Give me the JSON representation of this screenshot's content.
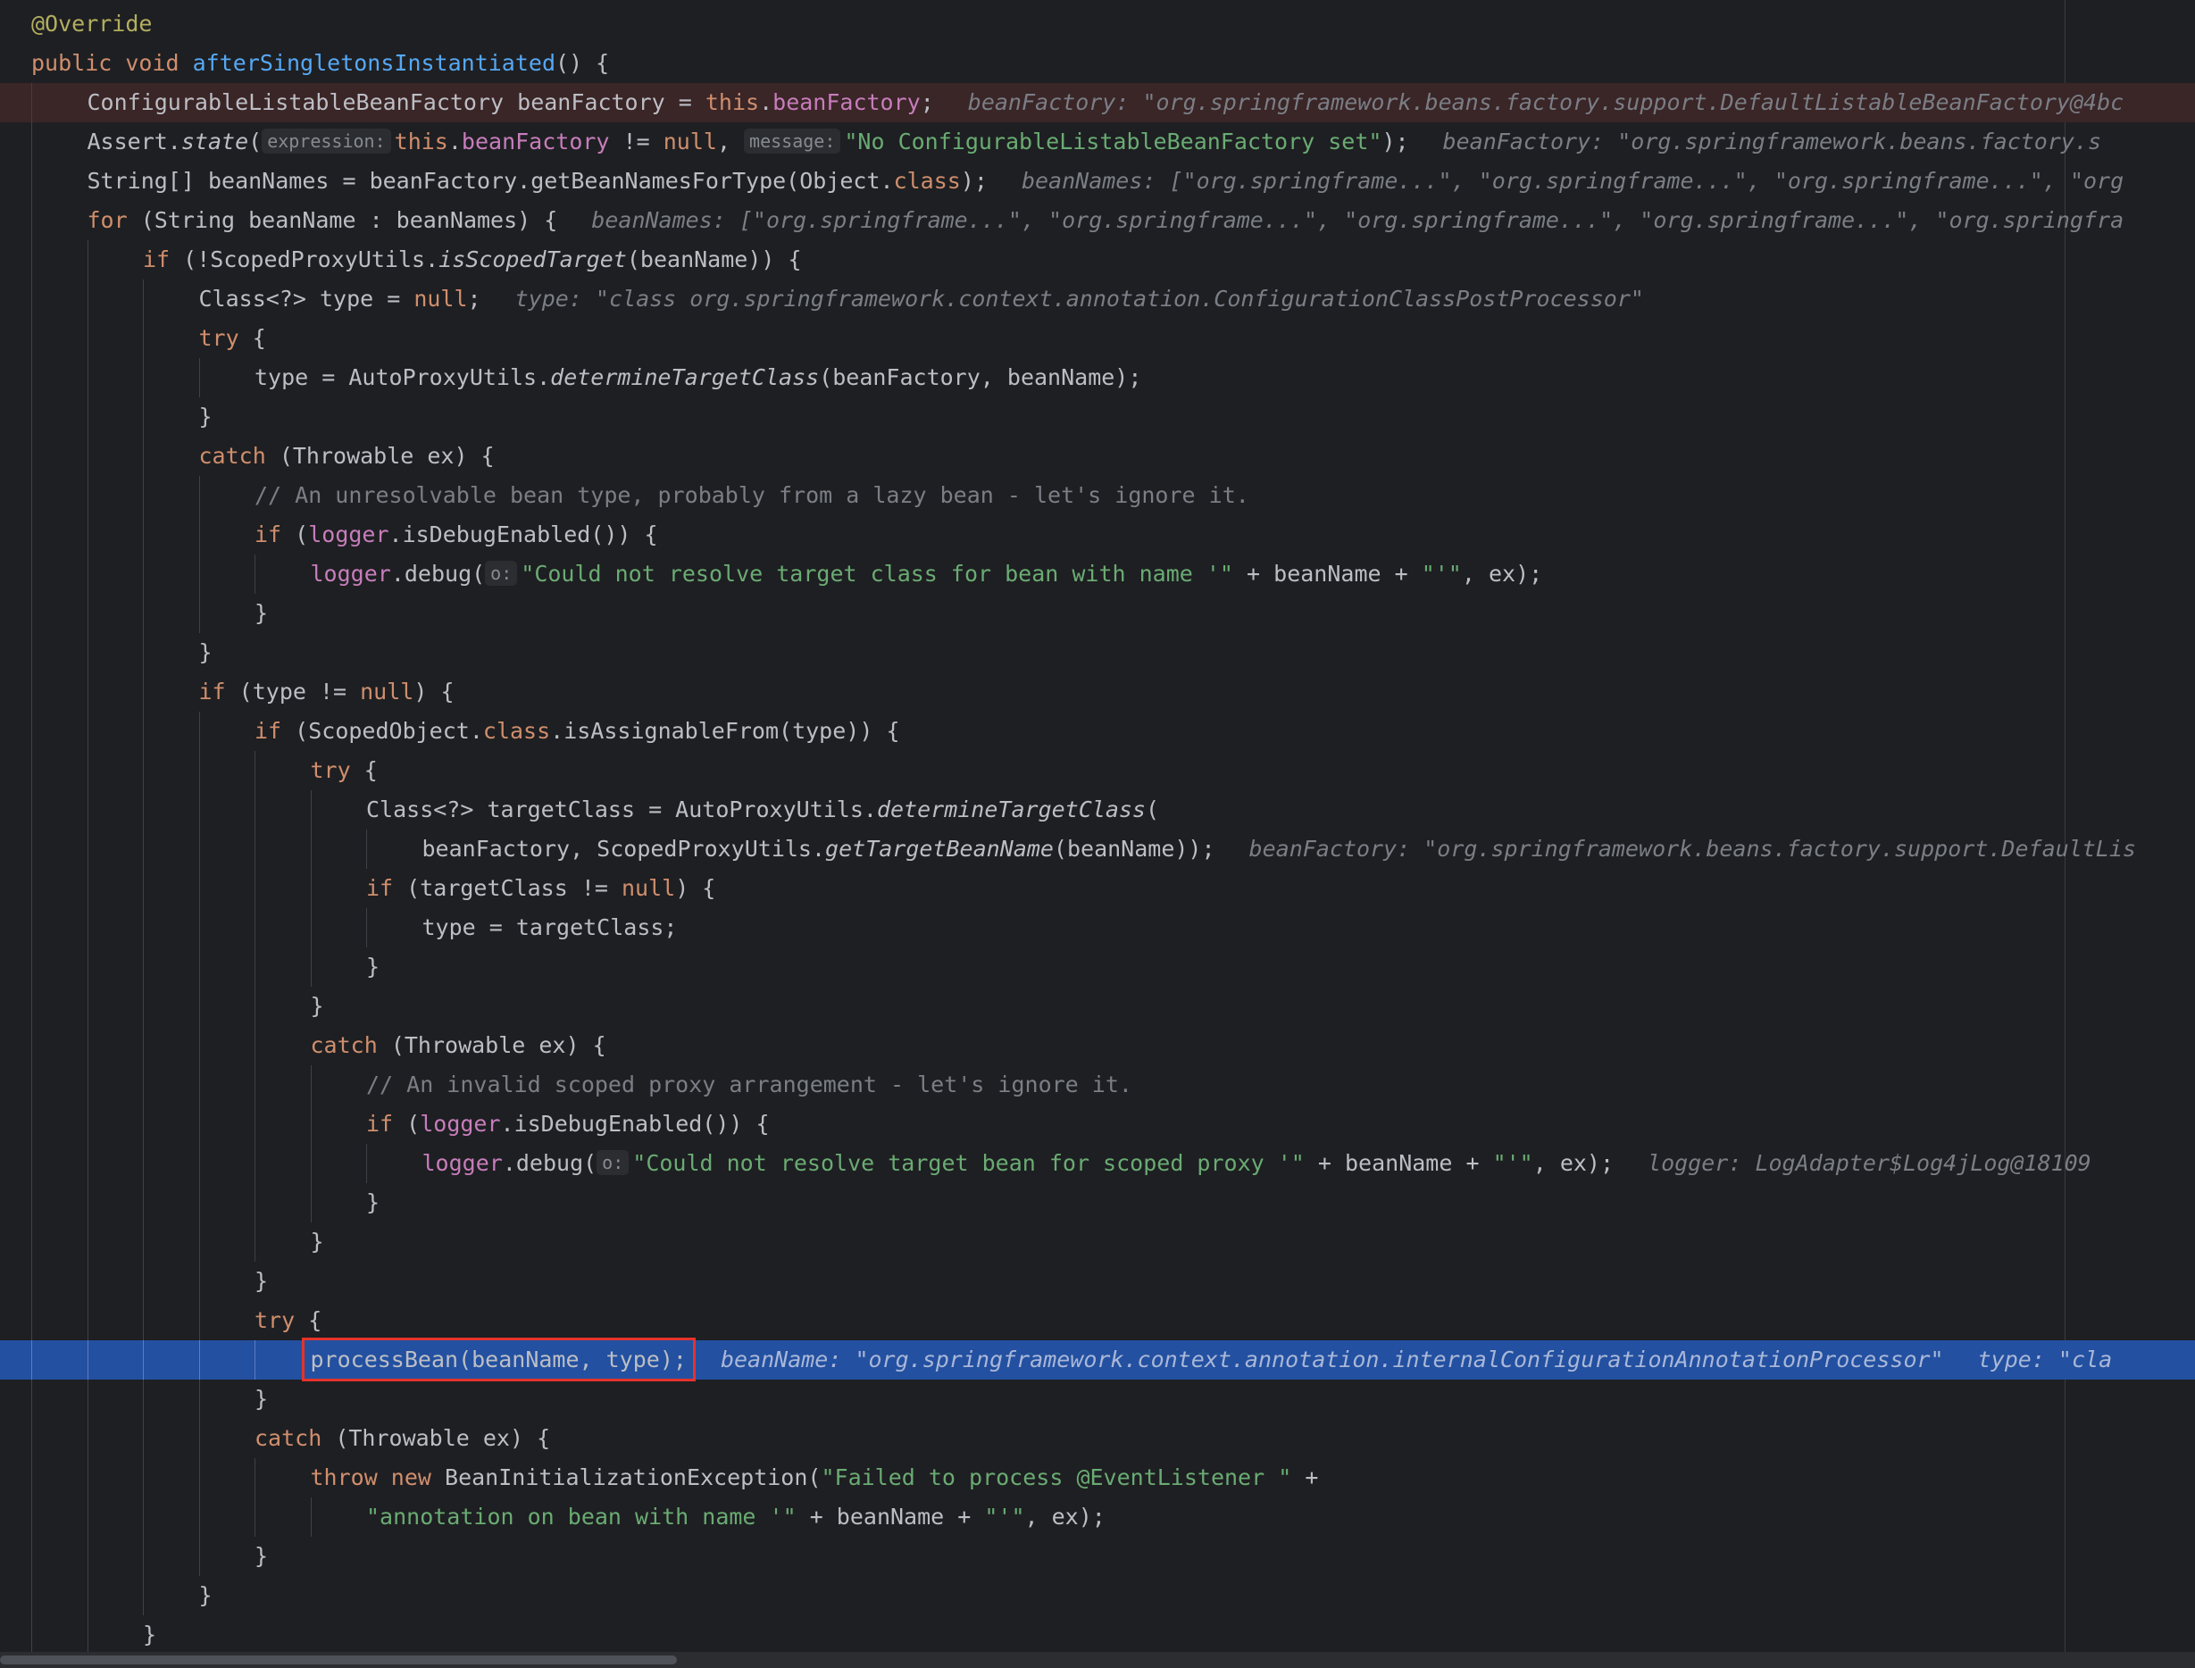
{
  "editor": {
    "lines": [
      {
        "indent": 0,
        "segs": [
          {
            "t": "@Override",
            "c": "ann"
          }
        ]
      },
      {
        "indent": 0,
        "segs": [
          {
            "t": "public void ",
            "c": "kw"
          },
          {
            "t": "afterSingletonsInstantiated",
            "c": "fn"
          },
          {
            "t": "() {"
          }
        ]
      },
      {
        "indent": 1,
        "state": "breakpoint",
        "segs": [
          {
            "t": "ConfigurableListableBeanFactory beanFactory = "
          },
          {
            "t": "this",
            "c": "kw"
          },
          {
            "t": "."
          },
          {
            "t": "beanFactory",
            "c": "fld"
          },
          {
            "t": ";"
          },
          {
            "t": "beanFactory: \"org.springframework.beans.factory.support.DefaultListableBeanFactory@4bc",
            "c": "hint"
          }
        ]
      },
      {
        "indent": 1,
        "segs": [
          {
            "t": "Assert."
          },
          {
            "t": "state",
            "c": "it"
          },
          {
            "t": "("
          },
          {
            "t": "expression:",
            "c": "phint"
          },
          {
            "t": "this",
            "c": "kw"
          },
          {
            "t": "."
          },
          {
            "t": "beanFactory",
            "c": "fld"
          },
          {
            "t": " != "
          },
          {
            "t": "null",
            "c": "kw"
          },
          {
            "t": ", "
          },
          {
            "t": "message:",
            "c": "phint"
          },
          {
            "t": "\"No ConfigurableListableBeanFactory set\"",
            "c": "str"
          },
          {
            "t": ");"
          },
          {
            "t": "beanFactory: \"org.springframework.beans.factory.s",
            "c": "hint"
          }
        ]
      },
      {
        "indent": 1,
        "segs": [
          {
            "t": "String[] beanNames = beanFactory.getBeanNamesForType(Object."
          },
          {
            "t": "class",
            "c": "kw"
          },
          {
            "t": ");"
          },
          {
            "t": "beanNames: [\"org.springframe...\", \"org.springframe...\", \"org.springframe...\", \"org",
            "c": "hint"
          }
        ]
      },
      {
        "indent": 1,
        "segs": [
          {
            "t": "for",
            "c": "kw"
          },
          {
            "t": " (String beanName : beanNames) {"
          },
          {
            "t": "beanNames: [\"org.springframe...\", \"org.springframe...\", \"org.springframe...\", \"org.springframe...\", \"org.springfra",
            "c": "hint"
          }
        ]
      },
      {
        "indent": 2,
        "segs": [
          {
            "t": "if",
            "c": "kw"
          },
          {
            "t": " (!ScopedProxyUtils."
          },
          {
            "t": "isScopedTarget",
            "c": "it"
          },
          {
            "t": "(beanName)) {"
          }
        ]
      },
      {
        "indent": 3,
        "segs": [
          {
            "t": "Class<?> type = "
          },
          {
            "t": "null",
            "c": "kw"
          },
          {
            "t": ";"
          },
          {
            "t": "type: \"class org.springframework.context.annotation.ConfigurationClassPostProcessor\"",
            "c": "hint"
          }
        ]
      },
      {
        "indent": 3,
        "segs": [
          {
            "t": "try",
            "c": "kw"
          },
          {
            "t": " {"
          }
        ]
      },
      {
        "indent": 4,
        "segs": [
          {
            "t": "type = AutoProxyUtils."
          },
          {
            "t": "determineTargetClass",
            "c": "it"
          },
          {
            "t": "(beanFactory, beanName);"
          }
        ]
      },
      {
        "indent": 3,
        "segs": [
          {
            "t": "}"
          }
        ]
      },
      {
        "indent": 3,
        "segs": [
          {
            "t": "catch",
            "c": "kw"
          },
          {
            "t": " (Throwable ex) {"
          }
        ]
      },
      {
        "indent": 4,
        "segs": [
          {
            "t": "// An unresolvable bean type, probably from a lazy bean - let's ignore it.",
            "c": "cmt"
          }
        ]
      },
      {
        "indent": 4,
        "segs": [
          {
            "t": "if",
            "c": "kw"
          },
          {
            "t": " ("
          },
          {
            "t": "logger",
            "c": "fld"
          },
          {
            "t": ".isDebugEnabled()) {"
          }
        ]
      },
      {
        "indent": 5,
        "segs": [
          {
            "t": "logger",
            "c": "fld"
          },
          {
            "t": ".debug("
          },
          {
            "t": "o:",
            "c": "phint"
          },
          {
            "t": "\"Could not resolve target class for bean with name '\"",
            "c": "str"
          },
          {
            "t": " + beanName + "
          },
          {
            "t": "\"'\"",
            "c": "str"
          },
          {
            "t": ", ex);"
          }
        ]
      },
      {
        "indent": 4,
        "segs": [
          {
            "t": "}"
          }
        ]
      },
      {
        "indent": 3,
        "segs": [
          {
            "t": "}"
          }
        ]
      },
      {
        "indent": 3,
        "segs": [
          {
            "t": "if",
            "c": "kw"
          },
          {
            "t": " (type != "
          },
          {
            "t": "null",
            "c": "kw"
          },
          {
            "t": ") {"
          }
        ]
      },
      {
        "indent": 4,
        "segs": [
          {
            "t": "if",
            "c": "kw"
          },
          {
            "t": " (ScopedObject."
          },
          {
            "t": "class",
            "c": "kw"
          },
          {
            "t": ".isAssignableFrom(type)) {"
          }
        ]
      },
      {
        "indent": 5,
        "segs": [
          {
            "t": "try",
            "c": "kw"
          },
          {
            "t": " {"
          }
        ]
      },
      {
        "indent": 6,
        "segs": [
          {
            "t": "Class<?> targetClass = AutoProxyUtils."
          },
          {
            "t": "determineTargetClass",
            "c": "it"
          },
          {
            "t": "("
          }
        ]
      },
      {
        "indent": 7,
        "segs": [
          {
            "t": "beanFactory, ScopedProxyUtils."
          },
          {
            "t": "getTargetBeanName",
            "c": "it"
          },
          {
            "t": "(beanName));"
          },
          {
            "t": "beanFactory: \"org.springframework.beans.factory.support.DefaultLis",
            "c": "hint"
          }
        ]
      },
      {
        "indent": 6,
        "segs": [
          {
            "t": "if",
            "c": "kw"
          },
          {
            "t": " (targetClass != "
          },
          {
            "t": "null",
            "c": "kw"
          },
          {
            "t": ") {"
          }
        ]
      },
      {
        "indent": 7,
        "segs": [
          {
            "t": "type = targetClass;"
          }
        ]
      },
      {
        "indent": 6,
        "segs": [
          {
            "t": "}"
          }
        ]
      },
      {
        "indent": 5,
        "segs": [
          {
            "t": "}"
          }
        ]
      },
      {
        "indent": 5,
        "segs": [
          {
            "t": "catch",
            "c": "kw"
          },
          {
            "t": " (Throwable ex) {"
          }
        ]
      },
      {
        "indent": 6,
        "segs": [
          {
            "t": "// An invalid scoped proxy arrangement - let's ignore it.",
            "c": "cmt"
          }
        ]
      },
      {
        "indent": 6,
        "segs": [
          {
            "t": "if",
            "c": "kw"
          },
          {
            "t": " ("
          },
          {
            "t": "logger",
            "c": "fld"
          },
          {
            "t": ".isDebugEnabled()) {"
          }
        ]
      },
      {
        "indent": 7,
        "segs": [
          {
            "t": "logger",
            "c": "fld"
          },
          {
            "t": ".debug("
          },
          {
            "t": "o:",
            "c": "phint"
          },
          {
            "t": "\"Could not resolve target bean for scoped proxy '\"",
            "c": "str"
          },
          {
            "t": " + beanName + "
          },
          {
            "t": "\"'\"",
            "c": "str"
          },
          {
            "t": ", ex);"
          },
          {
            "t": "logger: LogAdapter$Log4jLog@18109",
            "c": "hint"
          }
        ]
      },
      {
        "indent": 6,
        "segs": [
          {
            "t": "}"
          }
        ]
      },
      {
        "indent": 5,
        "segs": [
          {
            "t": "}"
          }
        ]
      },
      {
        "indent": 4,
        "segs": [
          {
            "t": "}"
          }
        ]
      },
      {
        "indent": 4,
        "segs": [
          {
            "t": "try",
            "c": "kw"
          },
          {
            "t": " {"
          }
        ]
      },
      {
        "indent": 5,
        "state": "current",
        "segs": [
          {
            "t": "processBean(beanName, type);",
            "c": "sel"
          },
          {
            "t": "beanName: \"org.springframework.context.annotation.internalConfigurationAnnotationProcessor\"",
            "c": "hint"
          },
          {
            "t": "type: \"cla",
            "c": "hint"
          }
        ]
      },
      {
        "indent": 4,
        "segs": [
          {
            "t": "}"
          }
        ]
      },
      {
        "indent": 4,
        "segs": [
          {
            "t": "catch",
            "c": "kw"
          },
          {
            "t": " (Throwable ex) {"
          }
        ]
      },
      {
        "indent": 5,
        "segs": [
          {
            "t": "throw new",
            "c": "kw"
          },
          {
            "t": " BeanInitializationException("
          },
          {
            "t": "\"Failed to process @EventListener \"",
            "c": "str"
          },
          {
            "t": " +"
          }
        ]
      },
      {
        "indent": 6,
        "segs": [
          {
            "t": "\"annotation on bean with name '\"",
            "c": "str"
          },
          {
            "t": " + beanName + "
          },
          {
            "t": "\"'\"",
            "c": "str"
          },
          {
            "t": ", ex);"
          }
        ]
      },
      {
        "indent": 4,
        "segs": [
          {
            "t": "}"
          }
        ]
      },
      {
        "indent": 3,
        "segs": [
          {
            "t": "}"
          }
        ]
      },
      {
        "indent": 2,
        "segs": [
          {
            "t": "}"
          }
        ]
      }
    ]
  }
}
